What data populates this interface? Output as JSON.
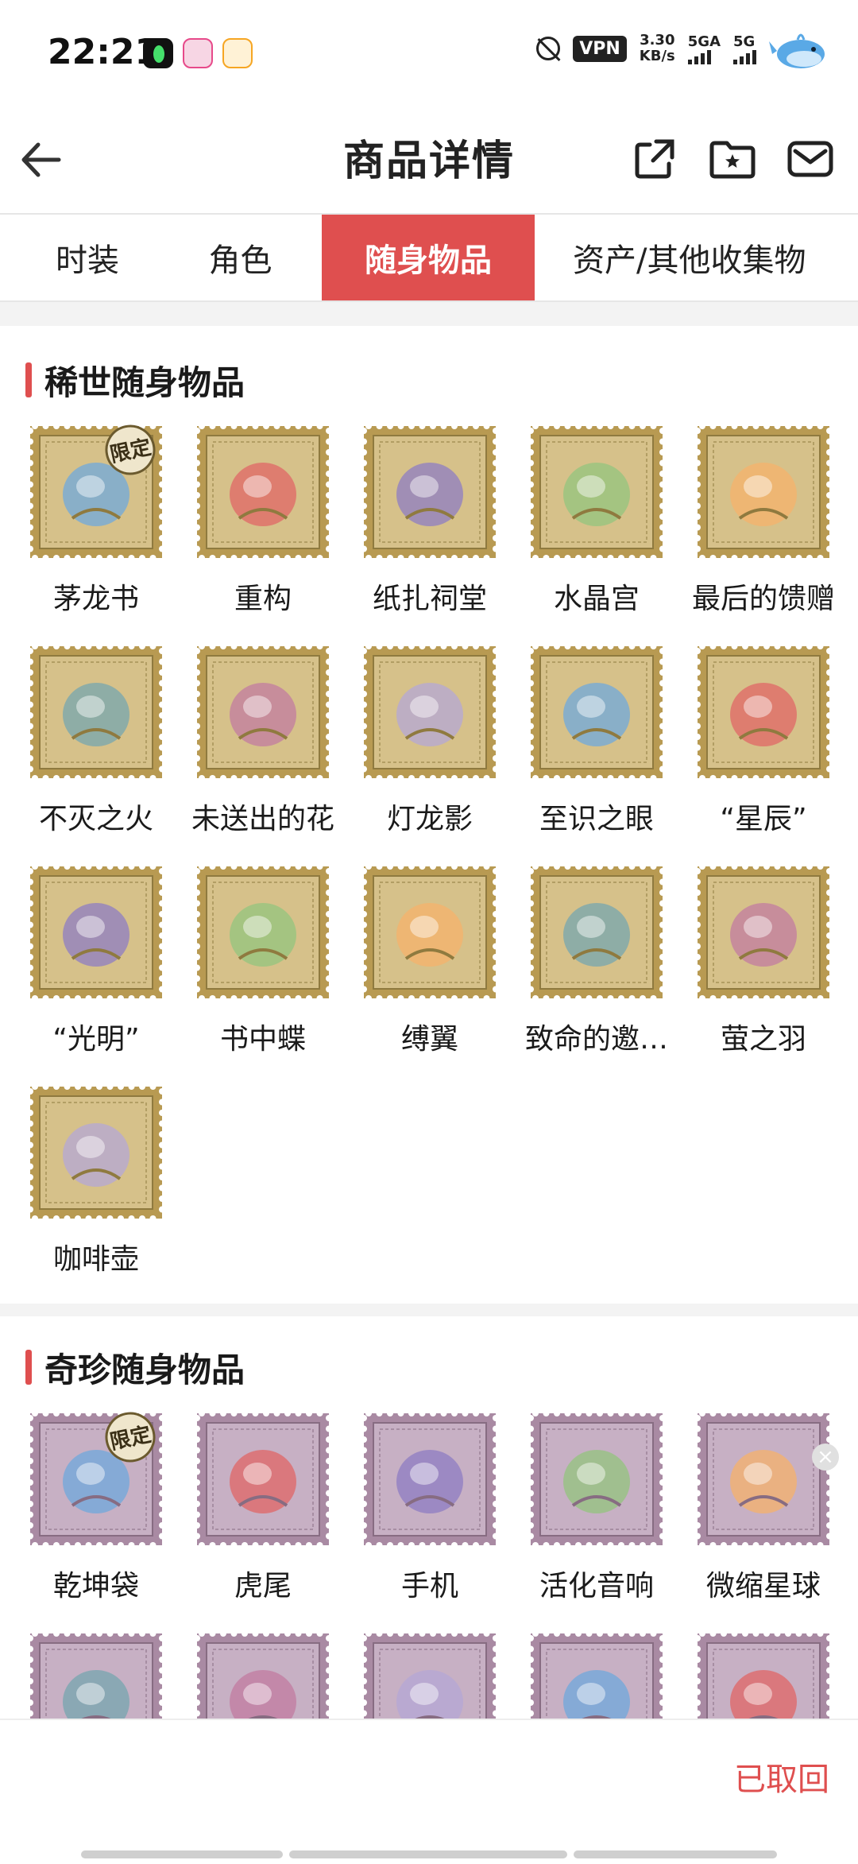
{
  "status_bar": {
    "time": "22:21",
    "vpn": "VPN",
    "speed_value": "3.30",
    "speed_unit": "KB/s",
    "signal1_label": "5GA",
    "signal2_label": "5G"
  },
  "header": {
    "title": "商品详情"
  },
  "tabs": [
    {
      "label": "时装"
    },
    {
      "label": "角色"
    },
    {
      "label": "随身物品"
    },
    {
      "label": "资产/其他收集物"
    }
  ],
  "rare_section": {
    "title": "稀世随身物品",
    "items": [
      {
        "name": "茅龙书",
        "badge": "限定"
      },
      {
        "name": "重构"
      },
      {
        "name": "纸扎祠堂"
      },
      {
        "name": "水晶宫"
      },
      {
        "name": "最后的馈赠"
      },
      {
        "name": "不灭之火"
      },
      {
        "name": "未送出的花"
      },
      {
        "name": "灯龙影"
      },
      {
        "name": "至识之眼"
      },
      {
        "name": "“星辰”"
      },
      {
        "name": "“光明”"
      },
      {
        "name": "书中蝶"
      },
      {
        "name": "缚翼"
      },
      {
        "name": "致命的邀…"
      },
      {
        "name": "萤之羽"
      },
      {
        "name": "咖啡壶"
      }
    ]
  },
  "treasure_section": {
    "title": "奇珍随身物品",
    "items": [
      {
        "name": "乾坤袋",
        "badge": "限定"
      },
      {
        "name": "虎尾"
      },
      {
        "name": "手机"
      },
      {
        "name": "活化音响"
      },
      {
        "name": "微缩星球"
      },
      {
        "name": ""
      },
      {
        "name": ""
      },
      {
        "name": ""
      },
      {
        "name": ""
      },
      {
        "name": ""
      }
    ]
  },
  "bottom_bar": {
    "status": "已取回"
  },
  "colors": {
    "accent": "#df4f4f",
    "gold_stamp": "#b89a52",
    "purple_stamp": "#a98aa3"
  }
}
